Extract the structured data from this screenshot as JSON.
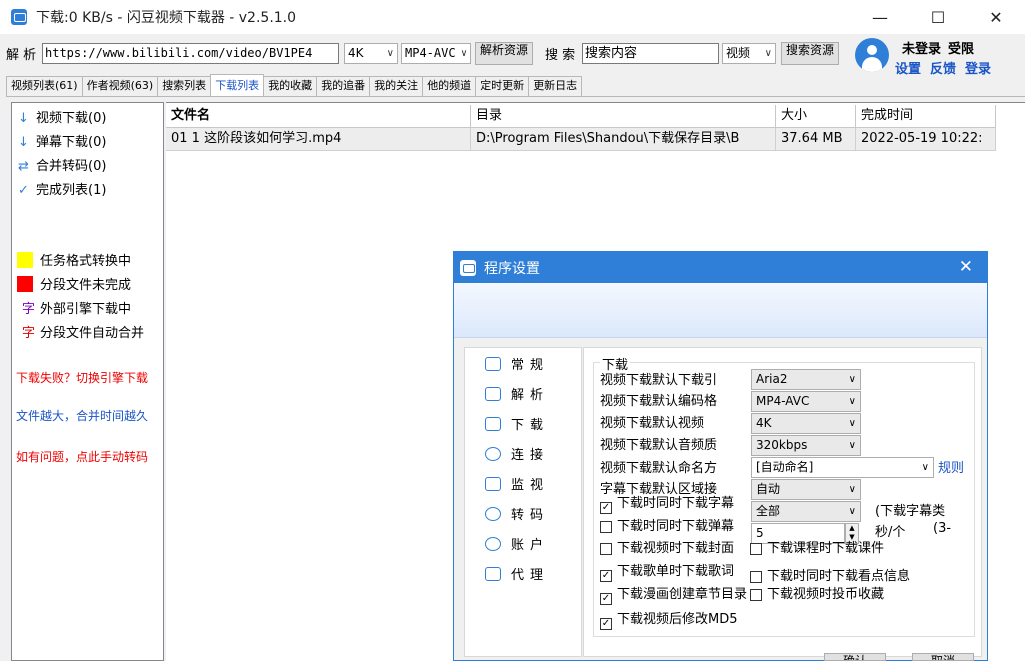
{
  "window": {
    "title": "下载:0 KB/s - 闪豆视频下载器 - v2.5.1.0",
    "minimize": "—",
    "maximize": "☐",
    "close": "✕"
  },
  "toolbar": {
    "parse_label": "解 析",
    "url_value": "https://www.bilibili.com/video/BV1PE4",
    "quality_value": "4K",
    "format_value": "MP4-AVC",
    "parse_button": "解析资源",
    "search_label": "搜 索",
    "search_value": "搜索内容",
    "search_type_value": "视频",
    "search_button": "搜索资源"
  },
  "user": {
    "status": "未登录",
    "privilege": "受限",
    "settings": "设置",
    "feedback": "反馈",
    "login": "登录"
  },
  "tabs": [
    "视频列表(61)",
    "作者视频(63)",
    "搜索列表",
    "下载列表",
    "我的收藏",
    "我的追番",
    "我的关注",
    "他的频道",
    "定时更新",
    "更新日志"
  ],
  "left_panel": {
    "items": [
      {
        "icon": "↓",
        "label": "视频下载(0)"
      },
      {
        "icon": "↓",
        "label": "弹幕下载(0)"
      },
      {
        "icon": "⇄",
        "label": "合并转码(0)"
      },
      {
        "icon": "✓",
        "label": "完成列表(1)"
      }
    ],
    "legend": [
      {
        "color": "#ffff00",
        "label": "任务格式转换中"
      },
      {
        "color": "#ff0000",
        "label": "分段文件未完成"
      },
      {
        "glyph": "字",
        "glyph_color": "#8000c0",
        "label": "外部引擎下载中"
      },
      {
        "glyph": "字",
        "glyph_color": "#e00000",
        "label": "分段文件自动合并"
      }
    ],
    "notes": {
      "fail": "下载失败？切换引擎下载",
      "merge": "文件越大，合并时间越久",
      "problem": "如有问题，点此手动转码"
    }
  },
  "table": {
    "headers": [
      "文件名",
      "目录",
      "大小",
      "完成时间"
    ],
    "rows": [
      [
        "01 1 这阶段该如何学习.mp4",
        "D:\\Program Files\\Shandou\\下载保存目录\\B",
        "37.64 MB",
        "2022-05-19 10:22:"
      ]
    ]
  },
  "dialog": {
    "title": "程序设置",
    "close": "✕",
    "nav": [
      "常规",
      "解析",
      "下载",
      "连接",
      "监视",
      "转码",
      "账户",
      "代理"
    ],
    "group_title": "下载",
    "rows": [
      {
        "label": "视频下载默认下载引",
        "value": "Aria2"
      },
      {
        "label": "视频下载默认编码格",
        "value": "MP4-AVC"
      },
      {
        "label": "视频下载默认视频",
        "value": "4K"
      },
      {
        "label": "视频下载默认音频质",
        "value": "320kbps"
      }
    ],
    "naming_label": "视频下载默认命名方",
    "naming_value": "[自动命名]",
    "naming_rule": "规则",
    "subtitle_region_label": "字幕下载默认区域接",
    "subtitle_region_value": "自动",
    "all_value": "全部",
    "sub_type_note": "(下载字幕类",
    "interval_value": "5",
    "interval_unit": "秒/个",
    "interval_note": "(3-",
    "checks": [
      {
        "label": "下载时同时下载字幕",
        "checked": "✓"
      },
      {
        "label": "下载时同时下载弹幕",
        "checked": ""
      },
      {
        "label": "下载视频时下载封面",
        "checked": ""
      },
      {
        "label": "下载歌单时下载歌词",
        "checked": "✓"
      },
      {
        "label": "下载漫画创建章节目录",
        "checked": "✓"
      },
      {
        "label": "下载视频后修改MD5",
        "checked": "✓"
      }
    ],
    "checks_right": [
      {
        "label": "下载课程时下载课件",
        "checked": ""
      },
      {
        "label": "下载时同时下载看点信息",
        "checked": ""
      },
      {
        "label": "下载视频时投币收藏",
        "checked": ""
      }
    ],
    "ok": "确认",
    "cancel": "取消"
  }
}
